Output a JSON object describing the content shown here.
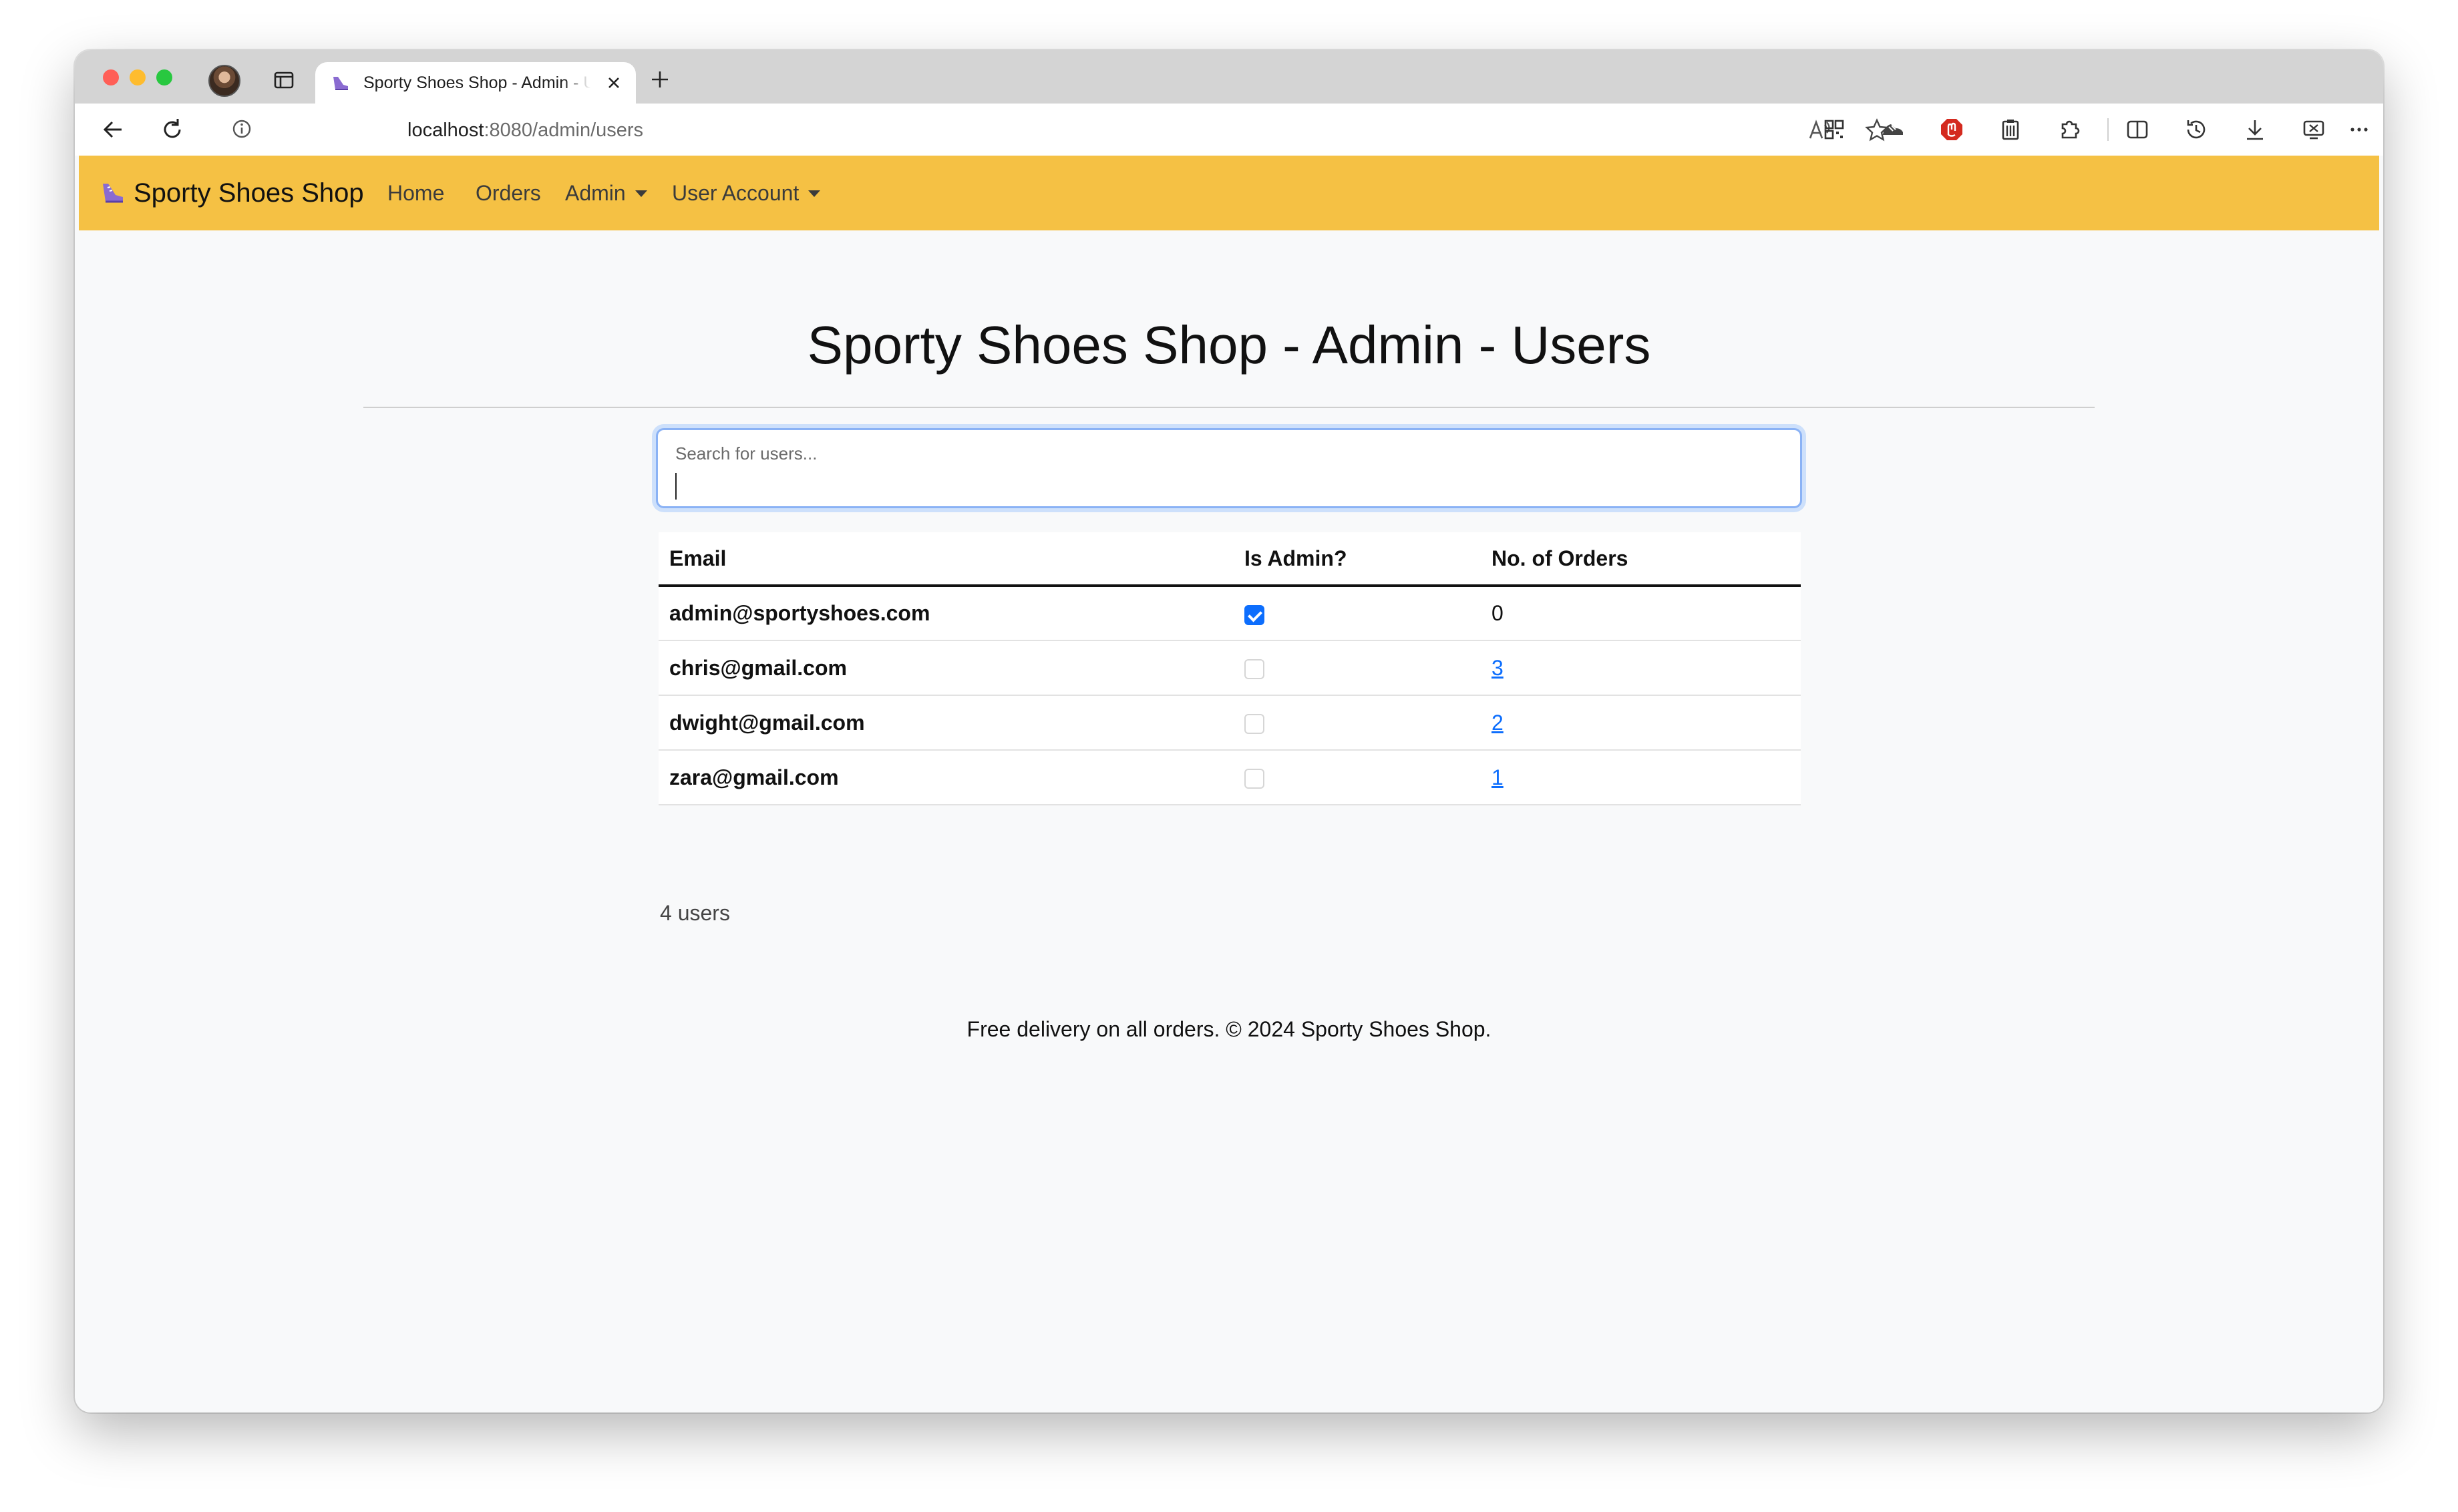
{
  "browser": {
    "tab_title": "Sporty Shoes Shop - Admin - Users",
    "url_host": "localhost",
    "url_path": ":8080/admin/users",
    "icons": [
      "profile-avatar",
      "tab-actions-icon",
      "shoe-favicon",
      "close-icon",
      "plus-icon",
      "back-arrow-icon",
      "reload-icon",
      "info-icon",
      "read-aloud-icon",
      "star-icon",
      "qr-code-icon",
      "shoe-extension-icon",
      "adblock-icon",
      "clipboard-icon",
      "extensions-icon",
      "split-screen-icon",
      "history-icon",
      "download-icon",
      "screenshot-icon",
      "more-icon"
    ]
  },
  "navbar": {
    "brand": "Sporty Shoes Shop",
    "links": {
      "home": "Home",
      "orders": "Orders",
      "admin": "Admin",
      "user_account": "User Account"
    },
    "background": "#f5c144"
  },
  "page": {
    "title": "Sporty Shoes Shop - Admin - Users",
    "search_placeholder": "Search for users...",
    "search_value": ""
  },
  "table": {
    "headers": {
      "email": "Email",
      "is_admin": "Is Admin?",
      "orders": "No. of Orders"
    },
    "rows": [
      {
        "email": "admin@sportyshoes.com",
        "is_admin": true,
        "orders": "0",
        "orders_link": false
      },
      {
        "email": "chris@gmail.com",
        "is_admin": false,
        "orders": "3",
        "orders_link": true
      },
      {
        "email": "dwight@gmail.com",
        "is_admin": false,
        "orders": "2",
        "orders_link": true
      },
      {
        "email": "zara@gmail.com",
        "is_admin": false,
        "orders": "1",
        "orders_link": true
      }
    ],
    "count_label": "4 users"
  },
  "footer": {
    "text": "Free delivery on all orders. © 2024 Sporty Shoes Shop."
  },
  "colors": {
    "accent": "#0d6efd",
    "navbar": "#f5c144"
  }
}
